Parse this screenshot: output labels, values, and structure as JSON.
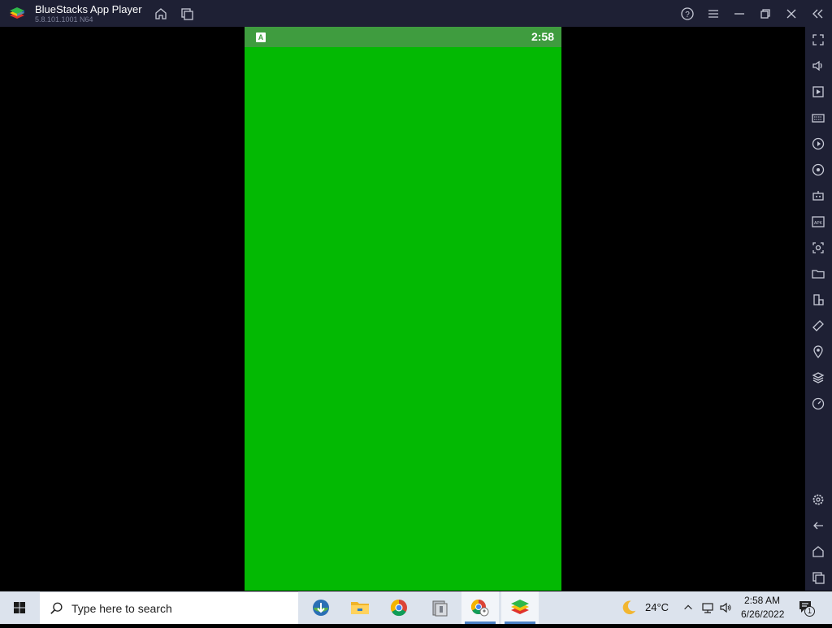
{
  "window": {
    "title": "BlueStacks App Player",
    "version": "5.8.101.1001 N64"
  },
  "android": {
    "status_time": "2:58",
    "notification_letter": "A",
    "screen_color": "#03b903"
  },
  "sidebar": {
    "items": [
      "fullscreen-icon",
      "volume-icon",
      "screen-recorder-icon",
      "keyboard-controls-icon",
      "macro-icon",
      "game-controls-icon",
      "bot-icon",
      "install-apk-icon",
      "screenshot-icon",
      "media-folder-icon",
      "multi-instance-icon",
      "rotate-icon",
      "location-icon",
      "layers-icon",
      "eco-mode-icon",
      "settings-icon",
      "back-icon",
      "home-icon",
      "recent-apps-icon"
    ]
  },
  "taskbar": {
    "search_placeholder": "Type here to search",
    "weather_temp": "24°C",
    "time": "2:58 AM",
    "date": "6/26/2022",
    "notification_count": "1"
  }
}
